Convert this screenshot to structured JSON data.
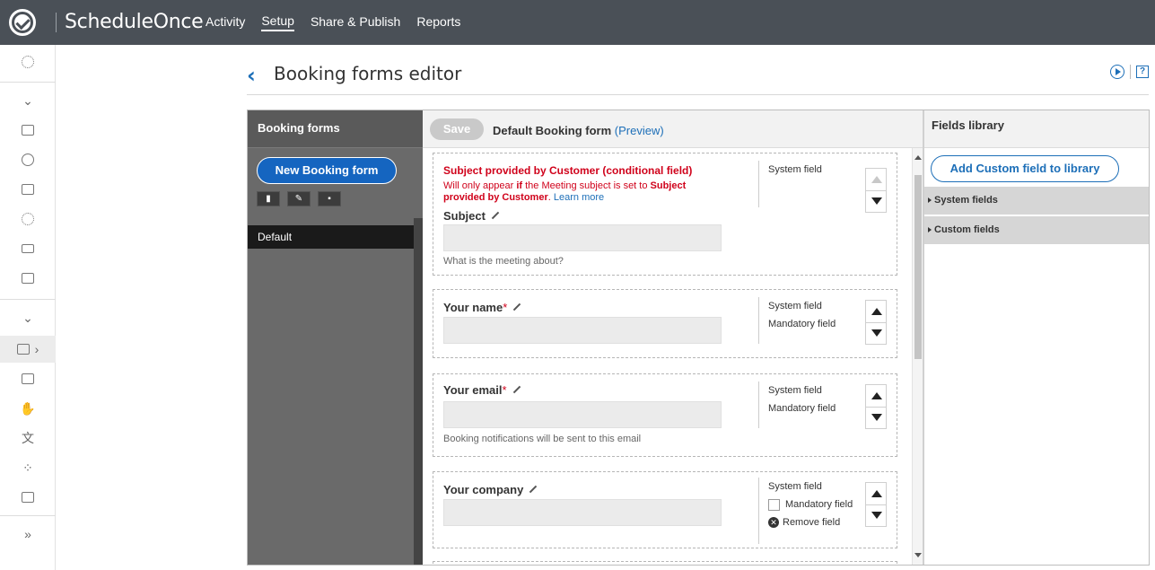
{
  "app": {
    "brand": "ScheduleOnce",
    "nav": [
      {
        "label": "Activity",
        "active": false
      },
      {
        "label": "Setup",
        "active": true
      },
      {
        "label": "Share & Publish",
        "active": false
      },
      {
        "label": "Reports",
        "active": false
      }
    ]
  },
  "header": {
    "title": "Booking forms editor",
    "help_label": "?"
  },
  "forms_panel": {
    "title": "Booking forms",
    "new_button": "New Booking form",
    "items": [
      {
        "label": "Default",
        "selected": true
      }
    ]
  },
  "center": {
    "save_label": "Save",
    "form_title": "Default Booking form",
    "preview_label": "(Preview)",
    "fields": [
      {
        "conditional_title": "Subject provided by Customer (conditional field)",
        "cond_text_1": "Will only appear ",
        "cond_bold_1": "if",
        "cond_text_2": " the Meeting subject is set to ",
        "cond_bold_2": "Subject provided by Customer",
        "cond_text_3": ". ",
        "learn_more": "Learn more",
        "name": "Subject",
        "help": "What is the meeting about?",
        "meta": [
          "System field"
        ]
      },
      {
        "name": "Your name",
        "required": "*",
        "help": "",
        "meta": [
          "System field",
          "Mandatory field"
        ]
      },
      {
        "name": "Your email",
        "required": "*",
        "help": "Booking notifications will be sent to this email",
        "meta": [
          "System field",
          "Mandatory field"
        ]
      },
      {
        "name": "Your company",
        "help": "",
        "meta": [
          "System field"
        ],
        "mandatory_checkbox_label": "Mandatory field",
        "remove_label": "Remove field"
      }
    ]
  },
  "library": {
    "title": "Fields library",
    "add_button": "Add Custom field to library",
    "sections": [
      "System fields",
      "Custom fields"
    ]
  },
  "colors": {
    "topbar": "#4a5057",
    "accent": "#1d6fb8",
    "warning": "#d0021b"
  }
}
